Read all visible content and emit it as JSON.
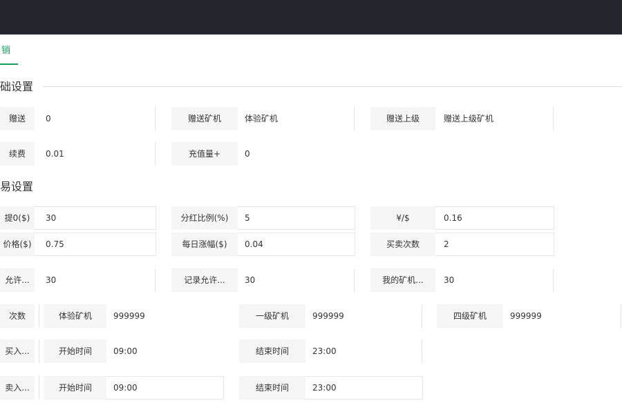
{
  "tab": {
    "label": "销"
  },
  "sections": {
    "first": "础设置",
    "second": "易设置"
  },
  "row1": [
    {
      "label": "赠送",
      "value": "0"
    },
    {
      "label": "赠送矿机",
      "value": "体验矿机"
    },
    {
      "label": "赠送上级",
      "value": "赠送上级矿机"
    }
  ],
  "row2": [
    {
      "label": "续费",
      "value": "0.01"
    },
    {
      "label": "充值量+",
      "value": "0"
    }
  ],
  "row3": [
    {
      "label": "提0($)",
      "value": "30"
    },
    {
      "label": "分红比例(%)",
      "value": "5"
    },
    {
      "label": "¥/$",
      "value": "0.16"
    }
  ],
  "row4": [
    {
      "label": "价格($)",
      "value": "0.75"
    },
    {
      "label": "每日涨幅($)",
      "value": "0.04"
    },
    {
      "label": "买卖次数",
      "value": "2"
    }
  ],
  "row5": [
    {
      "label": "允许...",
      "value": "30"
    },
    {
      "label": "记录允许...",
      "value": "30"
    },
    {
      "label": "我的矿机...",
      "value": "30"
    }
  ],
  "row6": [
    {
      "label": "次数",
      "value": ""
    },
    {
      "label": "体验矿机",
      "value": "999999"
    },
    {
      "label": "一级矿机",
      "value": "999999"
    },
    {
      "label": "四级矿机",
      "value": "999999"
    }
  ],
  "row7": [
    {
      "label": "买入...",
      "value": ""
    },
    {
      "label": "开始时间",
      "value": "09:00"
    },
    {
      "label": "结束时间",
      "value": "23:00"
    }
  ],
  "row8": [
    {
      "label": "卖入...",
      "value": ""
    },
    {
      "label": "开始时间",
      "value": "09:00"
    },
    {
      "label": "结束时间",
      "value": "23:00"
    }
  ]
}
